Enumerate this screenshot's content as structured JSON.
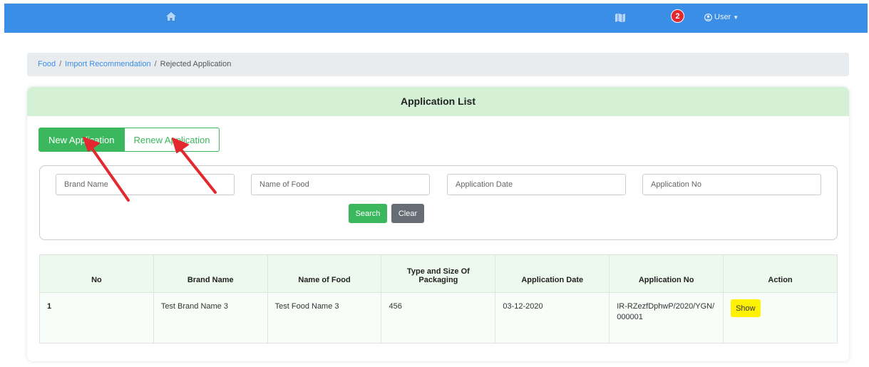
{
  "topbar": {
    "bg_color": "#3a8ee6",
    "home_icon": "home-icon",
    "map_icon": "map-icon",
    "bell_icon": "bell-icon",
    "notification_count": "2",
    "user_label": "User",
    "user_icon": "user-circle-icon"
  },
  "breadcrumb": {
    "items": [
      "Food",
      "Import Recommendation",
      "Rejected Application"
    ],
    "separator": "/"
  },
  "card": {
    "title": "Application List",
    "header_color": "#d4f0d5"
  },
  "tabs": {
    "new_label": "New Application",
    "renew_label": "Renew Application",
    "accent": "#3bb85d"
  },
  "search": {
    "brand_placeholder": "Brand Name",
    "food_placeholder": "Name of Food",
    "date_placeholder": "Application Date",
    "app_no_placeholder": "Application No",
    "search_label": "Search",
    "clear_label": "Clear"
  },
  "table": {
    "columns": [
      "No",
      "Brand Name",
      "Name of Food",
      "Type and Size Of Packaging",
      "Application Date",
      "Application No",
      "Action"
    ],
    "rows": [
      {
        "no": "1",
        "brand": "Test Brand Name 3",
        "food": "Test Food Name 3",
        "packaging": "456",
        "date": "03-12-2020",
        "app_no": "IR-RZezfDphwP/2020/YGN/000001",
        "action": "Show"
      }
    ]
  },
  "annotation_color": "#e3282f"
}
